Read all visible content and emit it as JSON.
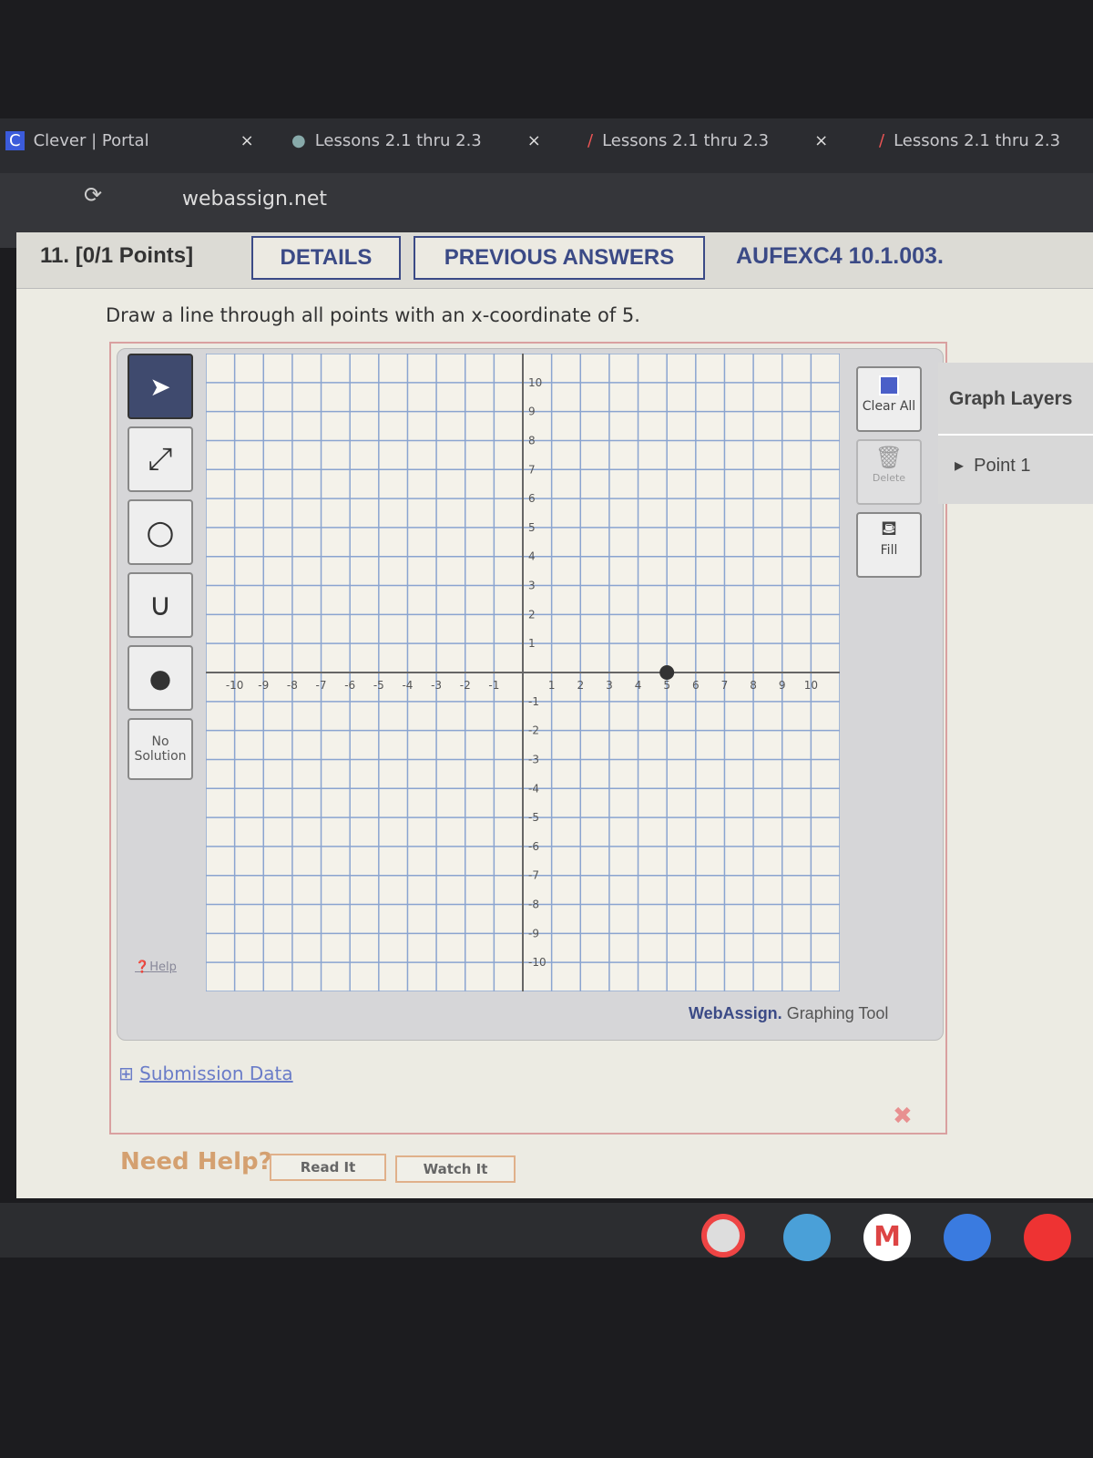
{
  "browser": {
    "tabs": [
      {
        "label": "Clever | Portal"
      },
      {
        "label": "Lessons 2.1 thru 2.3"
      },
      {
        "label": "Lessons 2.1 thru 2.3"
      },
      {
        "label": "Lessons 2.1 thru 2.3"
      }
    ],
    "url": "webassign.net"
  },
  "question": {
    "number": "11. [0/1 Points]",
    "details": "DETAILS",
    "previous": "PREVIOUS ANSWERS",
    "code": "AUFEXC4 10.1.003.",
    "prompt": "Draw a line through all points with an x-coordinate of 5."
  },
  "tools": {
    "no_solution": "No Solution",
    "help": "Help",
    "clear_all": "Clear All",
    "delete": "Delete",
    "fill": "Fill"
  },
  "layers": {
    "title": "Graph Layers",
    "items": [
      "Point 1"
    ]
  },
  "graph": {
    "xmin": -10,
    "xmax": 10,
    "ymin": -10,
    "ymax": 10,
    "grid": true,
    "points": [
      {
        "x": 5,
        "y": 0
      }
    ],
    "accent": "#3a5fb0"
  },
  "brand": {
    "name": "WebAssign.",
    "suffix": " Graphing Tool"
  },
  "submission": "Submission Data",
  "help": {
    "label": "Need Help?",
    "read": "Read It",
    "watch": "Watch It"
  }
}
